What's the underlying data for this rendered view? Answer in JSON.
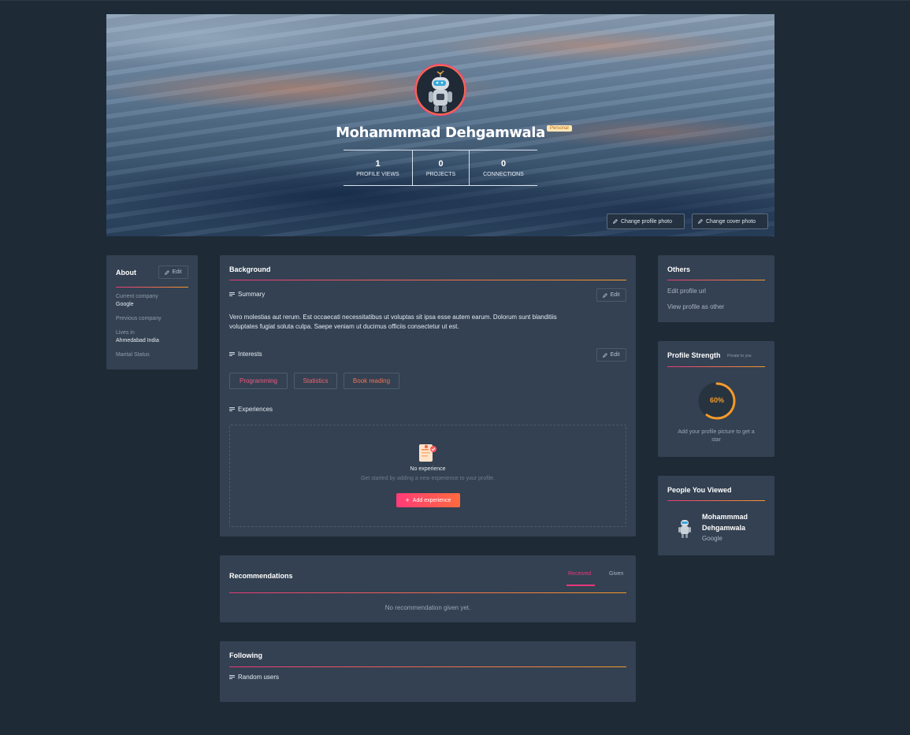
{
  "profile": {
    "name": "Mohammmad Dehgamwala",
    "badge": "Personal",
    "stats": [
      {
        "value": "1",
        "label": "PROFILE VIEWS"
      },
      {
        "value": "0",
        "label": "PROJECTS"
      },
      {
        "value": "0",
        "label": "CONNECTIONS"
      }
    ],
    "change_profile_photo": "Change profile photo",
    "change_cover_photo": "Change cover photo"
  },
  "about": {
    "title": "About",
    "edit": "Edit",
    "current_company_label": "Current company",
    "current_company": "Google",
    "previous_company_label": "Previous company",
    "lives_in_label": "Lives in",
    "lives_in": "Ahmedabad India",
    "marital_status_label": "Marital Status"
  },
  "background": {
    "title": "Background",
    "summary_title": "Summary",
    "summary_edit": "Edit",
    "summary_text_1": "Vero molestias aut rerum. Est occaecati necessitatibus ut voluptas sit ipsa esse autem earum. Dolorum sunt blanditiis",
    "summary_text_2": "voluptates fugiat soluta culpa. Saepe veniam ut ducimus officiis consectetur ut est.",
    "interests_title": "Interests",
    "interests_edit": "Edit",
    "interests": [
      "Programming",
      "Statistics",
      "Book reading"
    ],
    "experiences_title": "Experiences",
    "no_experience": "No experience",
    "no_experience_hint": "Get started by adding a new experience to your profile.",
    "add_experience": "Add experience"
  },
  "recommendations": {
    "title": "Recommendations",
    "tab_received": "Received",
    "tab_given": "Given",
    "empty": "No recommendation given yet."
  },
  "following": {
    "title": "Following",
    "random_users": "Random users"
  },
  "others": {
    "title": "Others",
    "edit_profile_url": "Edit profile url",
    "view_profile_as_other": "View profile as other"
  },
  "strength": {
    "title": "Profile Strength",
    "private_note": "Private to you",
    "percent_label": "60%",
    "percent": 60,
    "hint_1": "Add your profile picture to get a",
    "hint_2": "star"
  },
  "people_viewed": {
    "title": "People You Viewed",
    "name_line_1": "Mohammmad",
    "name_line_2": "Dehgamwala",
    "company": "Google"
  },
  "colors": {
    "page_bg": "#1e2a36",
    "card_bg": "#334152",
    "accent_pink": "#e8397a",
    "accent_orange": "#f49a2a"
  }
}
